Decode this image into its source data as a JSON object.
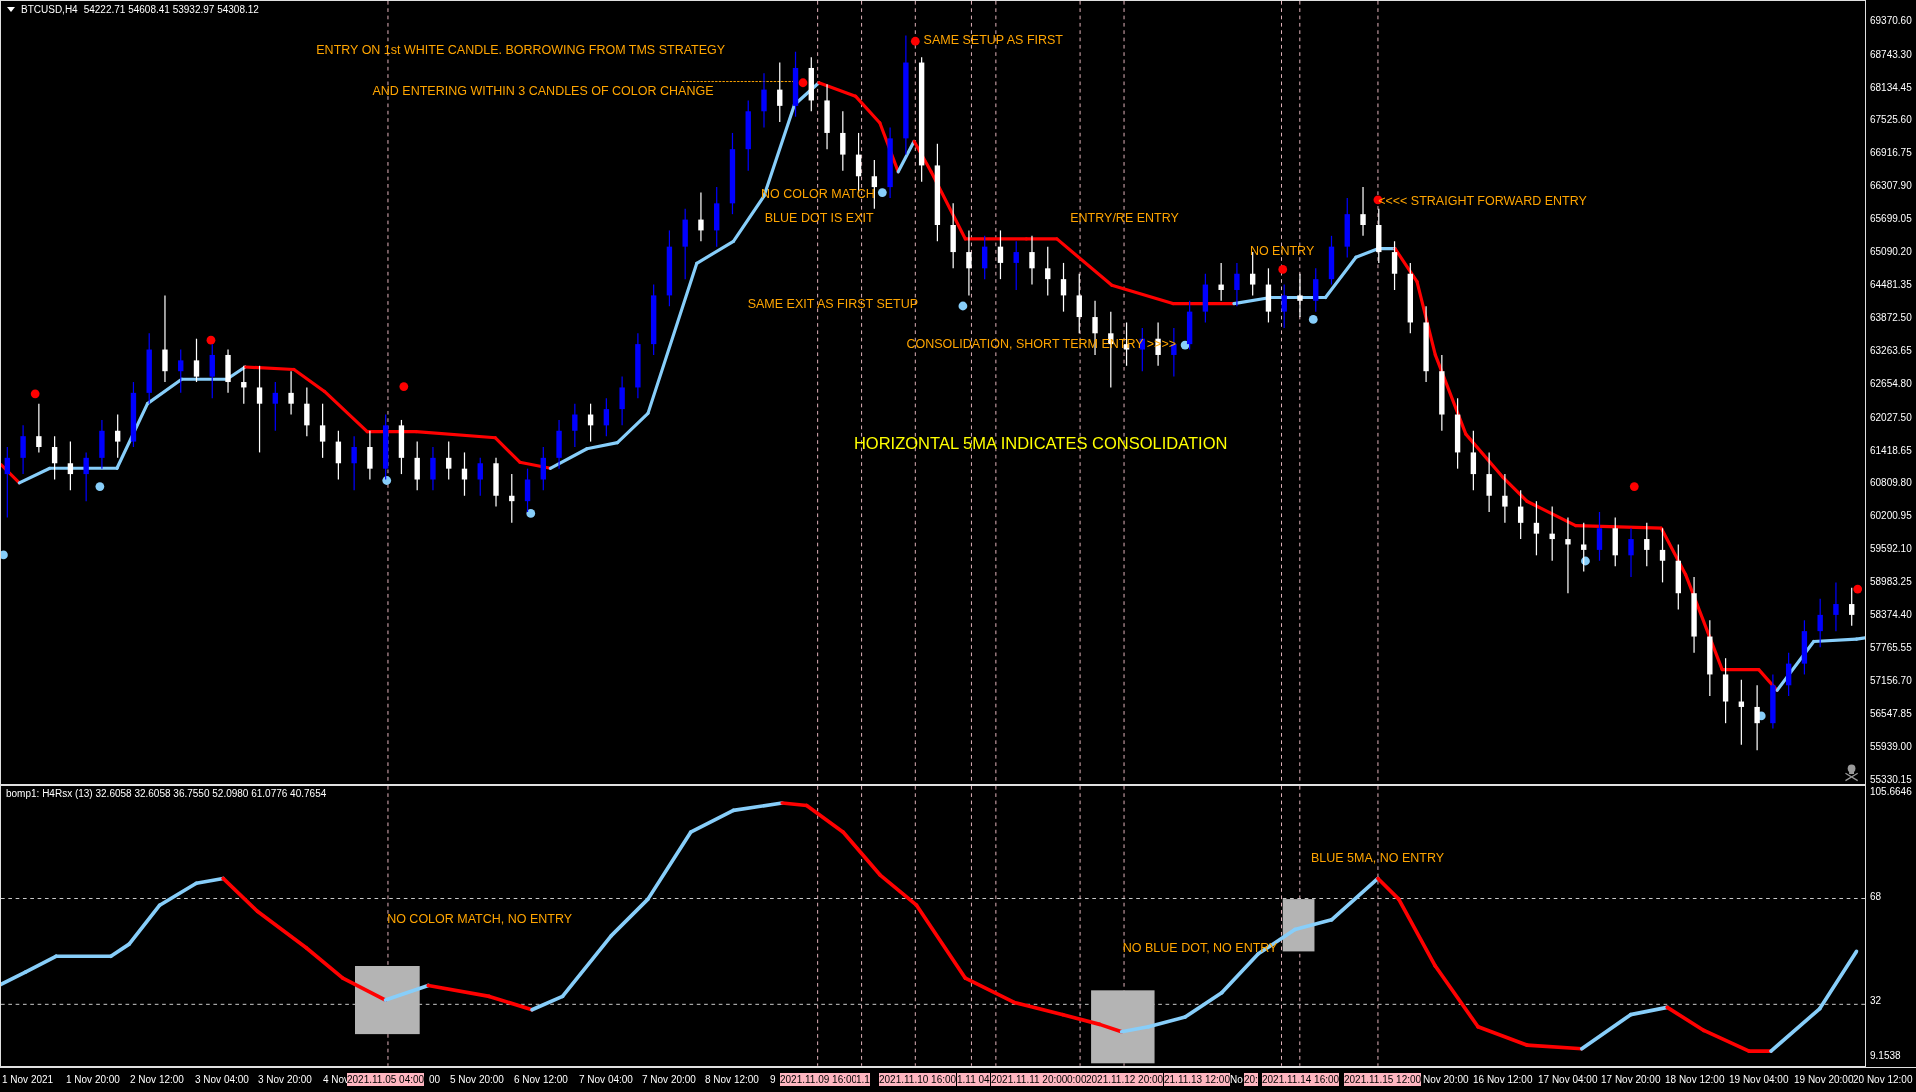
{
  "chart_header": {
    "symbol": "BTCUSD,H4",
    "ohlc": "54222.71 54608.41 53932.97 54308.12"
  },
  "annotations": [
    {
      "text": "ENTRY ON 1st WHITE CANDLE. BORROWING FROM TMS STRATEGY",
      "kind": "note"
    },
    {
      "text": "AND ENTERING WITHIN 3 CANDLES OF COLOR CHANGE",
      "kind": "note"
    },
    {
      "text": "SAME SETUP AS FIRST",
      "kind": "note"
    },
    {
      "text": "NO COLOR MATCH",
      "kind": "note"
    },
    {
      "text": "BLUE DOT IS EXIT",
      "kind": "note"
    },
    {
      "text": "ENTRY/RE ENTRY",
      "kind": "note"
    },
    {
      "text": "NO ENTRY",
      "kind": "note"
    },
    {
      "text": "<<<< STRAIGHT FORWARD ENTRY",
      "kind": "note"
    },
    {
      "text": "SAME EXIT AS FIRST SETUP",
      "kind": "note"
    },
    {
      "text": "CONSOLIDATION, SHORT TERM ENTRY >>>>",
      "kind": "note"
    },
    {
      "text": "HORIZONTAL 5MA INDICATES CONSOLIDATION",
      "kind": "headline"
    }
  ],
  "chart_data": {
    "type": "candlestick",
    "ylim": [
      55240,
      69755
    ],
    "yticks": [
      {
        "value": 69370.6,
        "label": "69370.60"
      },
      {
        "value": 68743.3,
        "label": "68743.30"
      },
      {
        "value": 68134.45,
        "label": "68134.45"
      },
      {
        "value": 67525.6,
        "label": "67525.60"
      },
      {
        "value": 66916.75,
        "label": "66916.75"
      },
      {
        "value": 66307.9,
        "label": "66307.90"
      },
      {
        "value": 65699.05,
        "label": "65699.05"
      },
      {
        "value": 65090.2,
        "label": "65090.20"
      },
      {
        "value": 64481.35,
        "label": "64481.35"
      },
      {
        "value": 63872.5,
        "label": "63872.50"
      },
      {
        "value": 63263.65,
        "label": "63263.65"
      },
      {
        "value": 62654.8,
        "label": "62654.80"
      },
      {
        "value": 62027.5,
        "label": "62027.50"
      },
      {
        "value": 61418.65,
        "label": "61418.65"
      },
      {
        "value": 60809.8,
        "label": "60809.80"
      },
      {
        "value": 60200.95,
        "label": "60200.95"
      },
      {
        "value": 59592.1,
        "label": "59592.10"
      },
      {
        "value": 58983.25,
        "label": "58983.25"
      },
      {
        "value": 58374.4,
        "label": "58374.40"
      },
      {
        "value": 57765.55,
        "label": "57765.55"
      },
      {
        "value": 57156.7,
        "label": "57156.70"
      },
      {
        "value": 56547.85,
        "label": "56547.85"
      },
      {
        "value": 55939,
        "label": "55939.00"
      },
      {
        "value": 55330.15,
        "label": "55330.15"
      }
    ],
    "ohlc": [
      [
        61000,
        61500,
        60200,
        61300
      ],
      [
        61300,
        61900,
        61000,
        61700
      ],
      [
        61700,
        62300,
        61400,
        61500
      ],
      [
        61500,
        61700,
        60900,
        61200
      ],
      [
        61200,
        61600,
        60700,
        61000
      ],
      [
        61000,
        61400,
        60500,
        61300
      ],
      [
        61300,
        62000,
        61100,
        61800
      ],
      [
        61800,
        62100,
        61300,
        61600
      ],
      [
        61600,
        62700,
        61500,
        62500
      ],
      [
        62500,
        63600,
        62300,
        63300
      ],
      [
        63300,
        64300,
        62700,
        62900
      ],
      [
        62900,
        63300,
        62500,
        63100
      ],
      [
        63100,
        63500,
        62700,
        62800
      ],
      [
        62800,
        63400,
        62400,
        63200
      ],
      [
        63200,
        63300,
        62500,
        62700
      ],
      [
        62700,
        63000,
        62300,
        62600
      ],
      [
        62600,
        63000,
        61400,
        62300
      ],
      [
        62300,
        62700,
        61800,
        62500
      ],
      [
        62500,
        62900,
        62100,
        62300
      ],
      [
        62300,
        62600,
        61700,
        61900
      ],
      [
        61900,
        62300,
        61300,
        61600
      ],
      [
        61600,
        61800,
        60900,
        61200
      ],
      [
        61200,
        61700,
        60700,
        61500
      ],
      [
        61500,
        61800,
        60900,
        61100
      ],
      [
        61100,
        62100,
        60900,
        61900
      ],
      [
        61900,
        62000,
        61000,
        61300
      ],
      [
        61300,
        61600,
        60700,
        60900
      ],
      [
        60900,
        61500,
        60700,
        61300
      ],
      [
        61300,
        61600,
        60900,
        61100
      ],
      [
        61100,
        61400,
        60600,
        60900
      ],
      [
        60900,
        61300,
        60600,
        61200
      ],
      [
        61200,
        61300,
        60400,
        60600
      ],
      [
        60600,
        61000,
        60100,
        60500
      ],
      [
        60500,
        61100,
        60300,
        60900
      ],
      [
        60900,
        61500,
        60700,
        61300
      ],
      [
        61300,
        62000,
        61100,
        61800
      ],
      [
        61800,
        62300,
        61500,
        62100
      ],
      [
        62100,
        62300,
        61600,
        61900
      ],
      [
        61900,
        62400,
        61700,
        62200
      ],
      [
        62200,
        62800,
        61900,
        62600
      ],
      [
        62600,
        63600,
        62400,
        63400
      ],
      [
        63400,
        64500,
        63200,
        64300
      ],
      [
        64300,
        65500,
        64100,
        65200
      ],
      [
        65200,
        65900,
        64600,
        65700
      ],
      [
        65700,
        66200,
        65300,
        65500
      ],
      [
        65500,
        66300,
        65200,
        66000
      ],
      [
        66000,
        67300,
        65800,
        67000
      ],
      [
        67000,
        67900,
        66600,
        67700
      ],
      [
        67700,
        68400,
        67400,
        68100
      ],
      [
        68100,
        68600,
        67500,
        67800
      ],
      [
        67800,
        68800,
        67600,
        68500
      ],
      [
        68500,
        68700,
        67700,
        67900
      ],
      [
        67900,
        68200,
        67000,
        67300
      ],
      [
        67300,
        67700,
        66600,
        66900
      ],
      [
        66900,
        67300,
        66200,
        66500
      ],
      [
        66500,
        66800,
        65900,
        66300
      ],
      [
        66300,
        67400,
        66100,
        67200
      ],
      [
        67200,
        69100,
        66900,
        68600
      ],
      [
        68600,
        68700,
        66400,
        66700
      ],
      [
        66700,
        67100,
        65300,
        65600
      ],
      [
        65600,
        66000,
        64800,
        65100
      ],
      [
        65100,
        65500,
        64300,
        64800
      ],
      [
        64800,
        65400,
        64600,
        65200
      ],
      [
        65200,
        65500,
        64600,
        64900
      ],
      [
        64900,
        65300,
        64400,
        65100
      ],
      [
        65100,
        65400,
        64500,
        64800
      ],
      [
        64800,
        65200,
        64300,
        64600
      ],
      [
        64600,
        64900,
        64000,
        64300
      ],
      [
        64300,
        64700,
        63600,
        63900
      ],
      [
        63900,
        64200,
        63200,
        63600
      ],
      [
        63600,
        64000,
        62600,
        63400
      ],
      [
        63400,
        63800,
        63000,
        63300
      ],
      [
        63300,
        63700,
        62900,
        63500
      ],
      [
        63500,
        63800,
        63000,
        63200
      ],
      [
        63200,
        63700,
        62800,
        63400
      ],
      [
        63400,
        64200,
        63300,
        64000
      ],
      [
        64000,
        64700,
        63800,
        64500
      ],
      [
        64500,
        64900,
        64200,
        64400
      ],
      [
        64400,
        64900,
        64100,
        64700
      ],
      [
        64700,
        65100,
        64300,
        64500
      ],
      [
        64500,
        64800,
        63800,
        64000
      ],
      [
        64000,
        64500,
        63700,
        64300
      ],
      [
        64300,
        64700,
        63900,
        64200
      ],
      [
        64200,
        64800,
        64000,
        64600
      ],
      [
        64600,
        65400,
        64500,
        65200
      ],
      [
        65200,
        66100,
        65000,
        65800
      ],
      [
        65800,
        66300,
        65400,
        65600
      ],
      [
        65600,
        65900,
        64900,
        65100
      ],
      [
        65100,
        65300,
        64400,
        64700
      ],
      [
        64700,
        64900,
        63600,
        63800
      ],
      [
        63800,
        64100,
        62700,
        62900
      ],
      [
        62900,
        63200,
        61800,
        62100
      ],
      [
        62100,
        62400,
        61100,
        61400
      ],
      [
        61400,
        61800,
        60700,
        61000
      ],
      [
        61000,
        61400,
        60300,
        60600
      ],
      [
        60600,
        61000,
        60100,
        60400
      ],
      [
        60400,
        60700,
        59800,
        60100
      ],
      [
        60100,
        60500,
        59500,
        59900
      ],
      [
        59900,
        60400,
        59400,
        59800
      ],
      [
        59800,
        60200,
        58800,
        59700
      ],
      [
        59700,
        60100,
        59200,
        59600
      ],
      [
        59600,
        60300,
        59400,
        60000
      ],
      [
        60000,
        60200,
        59300,
        59500
      ],
      [
        59500,
        60000,
        59100,
        59800
      ],
      [
        59800,
        60100,
        59300,
        59600
      ],
      [
        59600,
        60000,
        59000,
        59400
      ],
      [
        59400,
        59700,
        58500,
        58800
      ],
      [
        58800,
        59100,
        57700,
        58000
      ],
      [
        58000,
        58300,
        56900,
        57300
      ],
      [
        57300,
        57600,
        56400,
        56800
      ],
      [
        56800,
        57200,
        56000,
        56700
      ],
      [
        56700,
        57100,
        55900,
        56400
      ],
      [
        56400,
        57300,
        56300,
        57100
      ],
      [
        57100,
        57700,
        56900,
        57500
      ],
      [
        57500,
        58300,
        57300,
        58100
      ],
      [
        58100,
        58700,
        57800,
        58400
      ],
      [
        58400,
        59000,
        58100,
        58600
      ],
      [
        58600,
        58900,
        58200,
        58400
      ]
    ]
  },
  "indicator": {
    "header": "bomp1: H4Rsx (13) 32.6058 32.6058 36.7550 52.0980 61.0776 40.7654",
    "annotations": [
      {
        "text": "NO COLOR MATCH, NO ENTRY",
        "kind": "note"
      },
      {
        "text": "BLUE 5MA, NO ENTRY",
        "kind": "note"
      },
      {
        "text": "NO BLUE DOT, NO ENTRY",
        "kind": "note"
      }
    ],
    "axis": [
      "105.6646",
      "68",
      "32",
      "9.1538"
    ]
  },
  "time_axis": [
    {
      "text": "1 Nov 2021",
      "marked": false
    },
    {
      "text": "1 Nov 20:00",
      "marked": false
    },
    {
      "text": "2 Nov 12:00",
      "marked": false
    },
    {
      "text": "3 Nov 04:00",
      "marked": false
    },
    {
      "text": "3 Nov 20:00",
      "marked": false
    },
    {
      "text": "4 Nov",
      "marked": false
    },
    {
      "text": "2021.11.05 04:00",
      "marked": true
    },
    {
      "text": "00",
      "marked": false
    },
    {
      "text": "5 Nov 20:00",
      "marked": false
    },
    {
      "text": "6 Nov 12:00",
      "marked": false
    },
    {
      "text": "7 Nov 04:00",
      "marked": false
    },
    {
      "text": "7 Nov 20:00",
      "marked": false
    },
    {
      "text": "8 Nov 12:00",
      "marked": false
    },
    {
      "text": "9",
      "marked": false
    },
    {
      "text": "2021.11.09 16:00",
      "marked": true
    },
    {
      "text": "1.1",
      "marked": true
    },
    {
      "text": "2021.11.10 16:00",
      "marked": true
    },
    {
      "text": "1.11 04",
      "marked": true
    },
    {
      "text": "2021.11.11 20:00",
      "marked": true
    },
    {
      "text": "0:00",
      "marked": true
    },
    {
      "text": "2021.11.12 20:00",
      "marked": true
    },
    {
      "text": "21.11.13 12:00",
      "marked": true
    },
    {
      "text": "No",
      "marked": false
    },
    {
      "text": "20:",
      "marked": true
    },
    {
      "text": "2021.11.14 16:00",
      "marked": true
    },
    {
      "text": "2021.11.15 12:00",
      "marked": true
    },
    {
      "text": "Nov 20:00",
      "marked": false
    },
    {
      "text": "16 Nov 12:00",
      "marked": false
    },
    {
      "text": "17 Nov 04:00",
      "marked": false
    },
    {
      "text": "17 Nov 20:00",
      "marked": false
    },
    {
      "text": "18 Nov 12:00",
      "marked": false
    },
    {
      "text": "19 Nov 04:00",
      "marked": false
    },
    {
      "text": "19 Nov 20:00",
      "marked": false
    },
    {
      "text": "20 Nov 12:00",
      "marked": false
    }
  ]
}
